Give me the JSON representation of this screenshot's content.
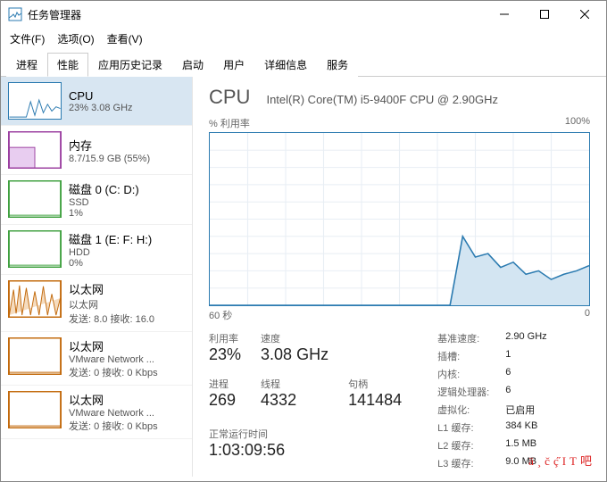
{
  "window": {
    "title": "任务管理器"
  },
  "menu": {
    "file": "文件(F)",
    "options": "选项(O)",
    "view": "查看(V)"
  },
  "tabs": [
    "进程",
    "性能",
    "应用历史记录",
    "启动",
    "用户",
    "详细信息",
    "服务"
  ],
  "activeTab": 1,
  "sidebar": [
    {
      "title": "CPU",
      "sub1": "23% 3.08 GHz",
      "color": "#2a7ab0",
      "type": "cpu"
    },
    {
      "title": "内存",
      "sub1": "8.7/15.9 GB (55%)",
      "color": "#9b3fa0",
      "type": "mem"
    },
    {
      "title": "磁盘 0 (C: D:)",
      "sub1": "SSD",
      "sub2": "1%",
      "color": "#3fa03f",
      "type": "disk"
    },
    {
      "title": "磁盘 1 (E: F: H:)",
      "sub1": "HDD",
      "sub2": "0%",
      "color": "#3fa03f",
      "type": "disk"
    },
    {
      "title": "以太网",
      "sub1": "以太网",
      "sub2": "发送: 8.0 接收: 16.0",
      "color": "#c2690b",
      "type": "net"
    },
    {
      "title": "以太网",
      "sub1": "VMware Network ...",
      "sub2": "发送: 0 接收: 0 Kbps",
      "color": "#c2690b",
      "type": "net-idle"
    },
    {
      "title": "以太网",
      "sub1": "VMware Network ...",
      "sub2": "发送: 0 接收: 0 Kbps",
      "color": "#c2690b",
      "type": "net-idle"
    }
  ],
  "main": {
    "heading": "CPU",
    "model": "Intel(R) Core(TM) i5-9400F CPU @ 2.90GHz",
    "chartTopLeft": "% 利用率",
    "chartTopRight": "100%",
    "chartBottomLeft": "60 秒",
    "chartBottomRight": "0",
    "stats": {
      "util_l": "利用率",
      "util_v": "23%",
      "speed_l": "速度",
      "speed_v": "3.08 GHz",
      "proc_l": "进程",
      "proc_v": "269",
      "thread_l": "线程",
      "thread_v": "4332",
      "handle_l": "句柄",
      "handle_v": "141484",
      "uptime_l": "正常运行时间",
      "uptime_v": "1:03:09:56"
    },
    "right": {
      "base_l": "基准速度:",
      "base_v": "2.90 GHz",
      "sockets_l": "插槽:",
      "sockets_v": "1",
      "cores_l": "内核:",
      "cores_v": "6",
      "lp_l": "逻辑处理器:",
      "lp_v": "6",
      "virt_l": "虚拟化:",
      "virt_v": "已启用",
      "l1_l": "L1 缓存:",
      "l1_v": "384 KB",
      "l2_l": "L2 缓存:",
      "l2_v": "1.5 MB",
      "l3_l": "L3 缓存:",
      "l3_v": "9.0 MB"
    }
  },
  "watermark": "ä¸čç̋IT吧",
  "chart_data": {
    "type": "line",
    "title": "% 利用率",
    "xlabel": "60 秒",
    "ylabel": "%",
    "ylim": [
      0,
      100
    ],
    "xlim_seconds": [
      60,
      0
    ],
    "x": [
      60,
      58,
      56,
      54,
      52,
      50,
      48,
      46,
      44,
      42,
      40,
      38,
      36,
      34,
      32,
      30,
      28,
      26,
      24,
      22,
      20,
      18,
      16,
      14,
      12,
      10,
      8,
      6,
      4,
      2,
      0
    ],
    "values": [
      0,
      0,
      0,
      0,
      0,
      0,
      0,
      0,
      0,
      0,
      0,
      0,
      0,
      0,
      0,
      0,
      0,
      0,
      0,
      0,
      40,
      28,
      30,
      22,
      25,
      18,
      20,
      15,
      18,
      20,
      23
    ]
  }
}
